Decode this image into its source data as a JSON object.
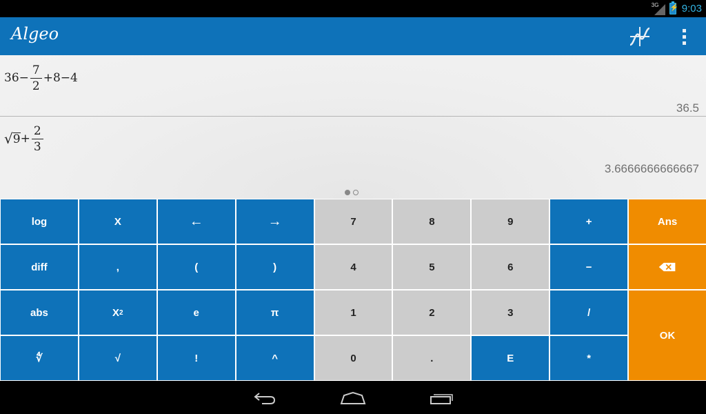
{
  "status_bar": {
    "signal_label": "3G",
    "time": "9:03"
  },
  "action_bar": {
    "title": "Algeo",
    "graph_icon": "graph-icon",
    "overflow_icon": "overflow-menu-icon"
  },
  "history": [
    {
      "expression": {
        "a": "36",
        "op1": "−",
        "frac_num": "7",
        "frac_den": "2",
        "rest": "+8−4"
      },
      "result": "36.5"
    },
    {
      "expression": {
        "sqrt_symbol": "√",
        "sqrt_arg": "9",
        "op1": "+",
        "frac_num": "2",
        "frac_den": "3"
      },
      "result": "3.6666666666667"
    }
  ],
  "page_indicator": {
    "current": 1,
    "total": 2
  },
  "keypad": {
    "log": "log",
    "x": "X",
    "left_arrow": "←",
    "right_arrow": "→",
    "seven": "7",
    "eight": "8",
    "nine": "9",
    "plus": "+",
    "ans": "Ans",
    "diff": "diff",
    "comma": ",",
    "lparen": "(",
    "rparen": ")",
    "four": "4",
    "five": "5",
    "six": "6",
    "minus": "−",
    "abs": "abs",
    "x_base": "X",
    "x_exp": "2",
    "e": "e",
    "pi": "π",
    "one": "1",
    "two": "2",
    "three": "3",
    "divide": "/",
    "nroot": "∜",
    "sqrt": "√",
    "factorial": "!",
    "caret": "^",
    "zero": "0",
    "dot": ".",
    "exp": "E",
    "multiply": "*",
    "ok": "OK"
  },
  "colors": {
    "primary_blue": "#0e72b9",
    "accent_orange": "#f08c00",
    "digit_gray": "#cccccc",
    "status_blue": "#33b5e5"
  }
}
